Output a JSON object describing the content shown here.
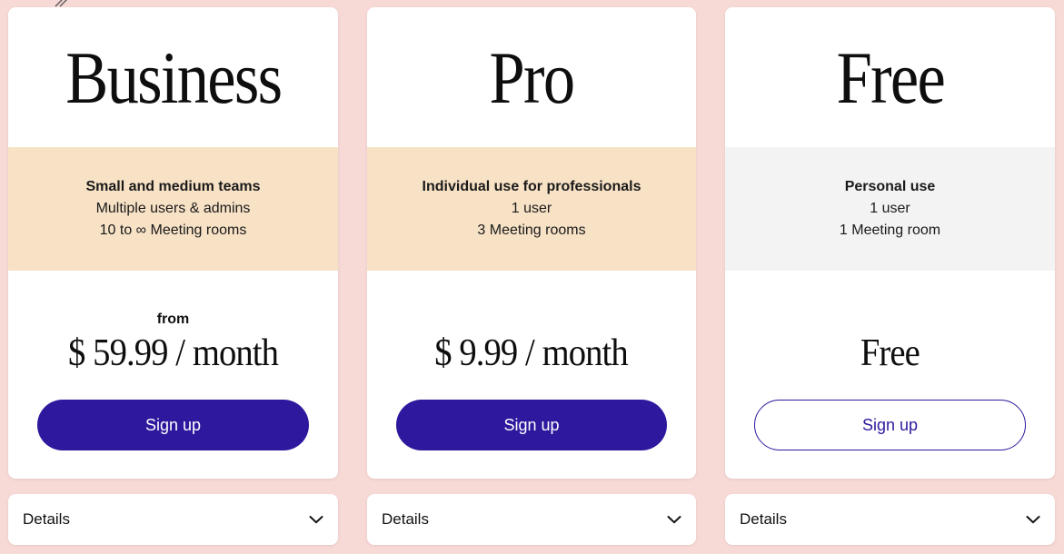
{
  "plans": [
    {
      "name": "Business",
      "features": {
        "title": "Small and medium teams",
        "line1": "Multiple users & admins",
        "line2": "10 to ∞ Meeting rooms"
      },
      "price_prefix": "from",
      "price": "$ 59.99 / month",
      "signup_label": "Sign up",
      "details_label": "Details"
    },
    {
      "name": "Pro",
      "features": {
        "title": "Individual use for professionals",
        "line1": "1 user",
        "line2": "3 Meeting rooms"
      },
      "price": "$ 9.99 / month",
      "signup_label": "Sign up",
      "details_label": "Details"
    },
    {
      "name": "Free",
      "features": {
        "title": "Personal use",
        "line1": "1 user",
        "line2": "1 Meeting room"
      },
      "price": "Free",
      "signup_label": "Sign up",
      "details_label": "Details"
    }
  ],
  "colors": {
    "background": "#f7d9d6",
    "accent": "#2e189d",
    "peach_band": "#f8e2c6",
    "grey_band": "#f3f3f3"
  },
  "icons": {
    "details_toggle": "chevron-down-icon",
    "corner_decoration": "slash-marks-icon"
  }
}
